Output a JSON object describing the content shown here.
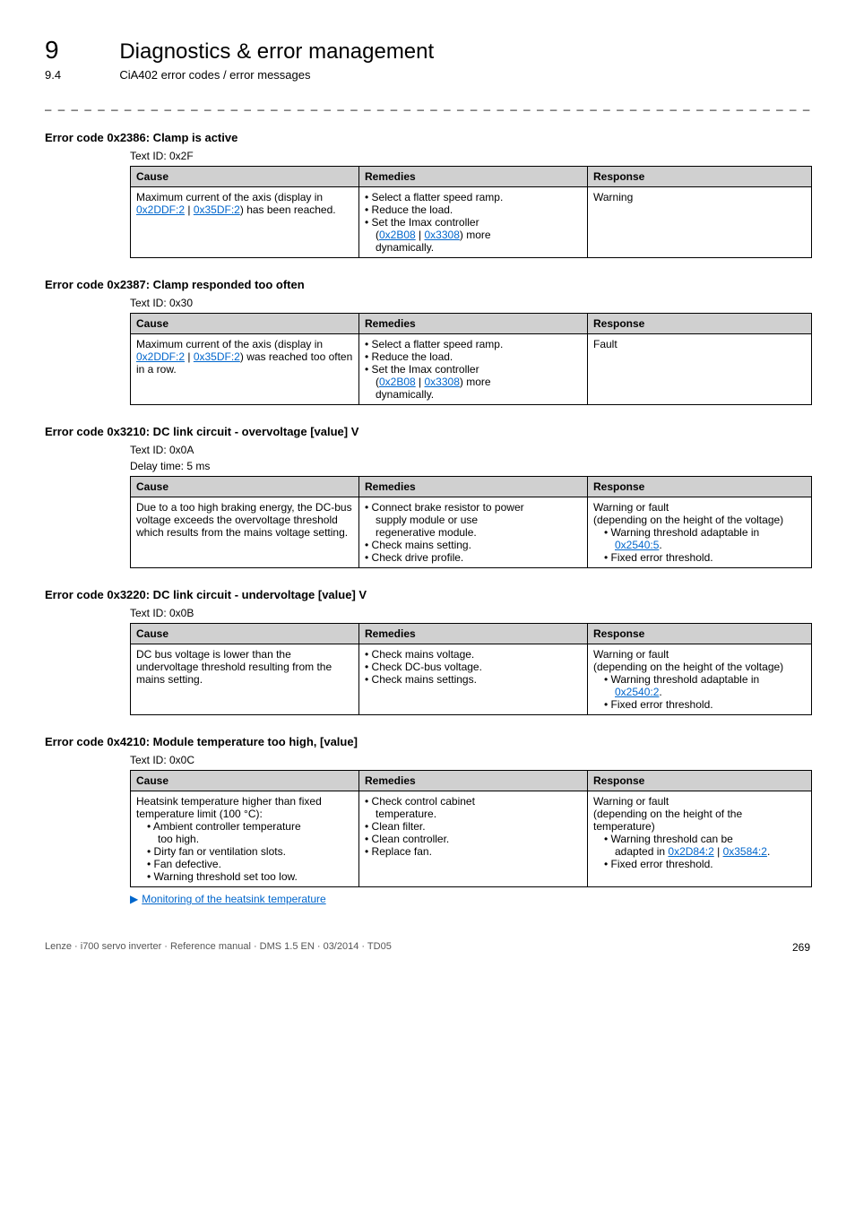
{
  "header": {
    "chapter_num": "9",
    "chapter_title": "Diagnostics & error management",
    "section_num": "9.4",
    "section_title": "CiA402 error codes / error messages"
  },
  "tableHeaders": {
    "cause": "Cause",
    "remedies": "Remedies",
    "response": "Response"
  },
  "errors": [
    {
      "title": "Error code 0x2386: Clamp is active",
      "text_id": "Text ID: 0x2F",
      "cause_pre": "Maximum current of the axis (display in ",
      "cause_link1": "0x2DDF:2",
      "cause_mid": " | ",
      "cause_link2": "0x35DF:2",
      "cause_post": ") has been reached.",
      "rem_l1": "• Select a flatter speed ramp.",
      "rem_l2": "• Reduce the load.",
      "rem_l3": "• Set the Imax controller",
      "rem_link_pre": "(",
      "rem_linkA": "0x2B08",
      "rem_link_mid": " | ",
      "rem_linkB": "0x3308",
      "rem_link_post": ") more",
      "rem_l5": "dynamically.",
      "response": "Warning"
    },
    {
      "title": "Error code 0x2387: Clamp responded too often",
      "text_id": "Text ID: 0x30",
      "cause_pre": "Maximum current of the axis (display in ",
      "cause_link1": "0x2DDF:2",
      "cause_mid": " | ",
      "cause_link2": "0x35DF:2",
      "cause_post": ") was reached too often in a row.",
      "rem_l1": "• Select a flatter speed ramp.",
      "rem_l2": "• Reduce the load.",
      "rem_l3": "• Set the Imax controller",
      "rem_link_pre": "(",
      "rem_linkA": "0x2B08",
      "rem_link_mid": " | ",
      "rem_linkB": "0x3308",
      "rem_link_post": ") more",
      "rem_l5": "dynamically.",
      "response": "Fault"
    }
  ],
  "err3": {
    "title": "Error code 0x3210: DC link circuit - overvoltage [value] V",
    "text_id": "Text ID: 0x0A",
    "delay": "Delay time: 5 ms",
    "cause": "Due to a too high braking energy, the DC-bus voltage exceeds the overvoltage threshold which results from the mains voltage setting.",
    "rem_l1": "• Connect brake resistor to power",
    "rem_l1b": "supply module or use",
    "rem_l1c": "regenerative module.",
    "rem_l2": "• Check mains setting.",
    "rem_l3": "• Check drive profile.",
    "resp_l1": "Warning or fault",
    "resp_l2": "(depending on the height of the voltage)",
    "resp_l3": "• Warning threshold adaptable in",
    "resp_link": "0x2540:5",
    "resp_post": ".",
    "resp_l4": "• Fixed error threshold."
  },
  "err4": {
    "title": "Error code 0x3220: DC link circuit - undervoltage [value] V",
    "text_id": "Text ID: 0x0B",
    "cause": "DC bus voltage is lower than the undervoltage threshold resulting from the mains setting.",
    "rem_l1": "• Check mains voltage.",
    "rem_l2": "• Check DC-bus voltage.",
    "rem_l3": "• Check mains settings.",
    "resp_l1": "Warning or fault",
    "resp_l2": "(depending on the height of the voltage)",
    "resp_l3": "• Warning threshold adaptable in",
    "resp_link": "0x2540:2",
    "resp_post": ".",
    "resp_l4": "• Fixed error threshold."
  },
  "err5": {
    "title": "Error code 0x4210: Module temperature too high, [value]",
    "text_id": "Text ID: 0x0C",
    "cause_l1": "Heatsink temperature higher than fixed temperature limit (100 °C):",
    "cause_l2": "• Ambient controller temperature",
    "cause_l2b": "too high.",
    "cause_l3": "• Dirty fan or ventilation slots.",
    "cause_l4": "• Fan defective.",
    "cause_l5": "• Warning threshold set too low.",
    "rem_l1": "• Check control cabinet",
    "rem_l1b": "temperature.",
    "rem_l2": "• Clean filter.",
    "rem_l3": "• Clean controller.",
    "rem_l4": "• Replace fan.",
    "resp_l1": "Warning or fault",
    "resp_l2": "(depending on the height of the temperature)",
    "resp_l3": "• Warning threshold can be",
    "resp_l3b_pre": "adapted in ",
    "resp_link1": "0x2D84:2",
    "resp_mid": " | ",
    "resp_link2": "0x3584:2",
    "resp_post": ".",
    "resp_l4": "• Fixed error threshold.",
    "footer_link": "Monitoring of the heatsink temperature"
  },
  "footer": {
    "text": "Lenze · i700 servo inverter · Reference manual · DMS 1.5 EN · 03/2014 · TD05",
    "page": "269"
  }
}
